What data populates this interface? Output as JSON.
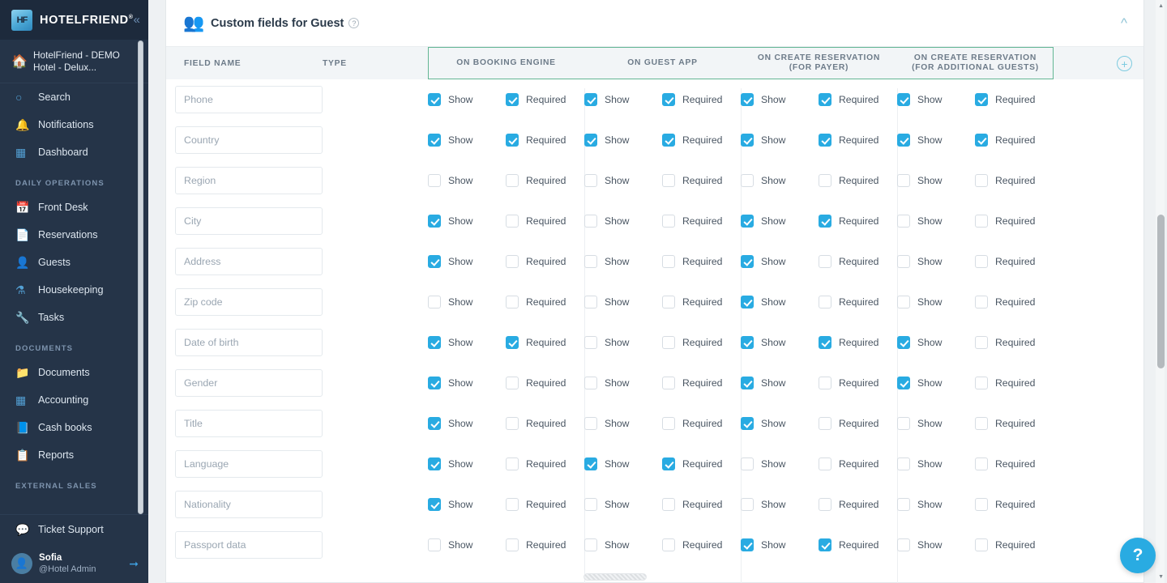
{
  "sidebar": {
    "brand": {
      "name": "HOTELFRIEND",
      "registered": "®",
      "logo_icon": "hotelfriend-cube-icon",
      "collapse_icon": "chevron-double-left-icon"
    },
    "hotel": {
      "icon": "home-icon",
      "line1": "HotelFriend - DEMO",
      "line2": "Hotel - Delux..."
    },
    "top_items": [
      {
        "label": "Search",
        "icon": "search-icon"
      },
      {
        "label": "Notifications",
        "icon": "bell-icon"
      },
      {
        "label": "Dashboard",
        "icon": "grid-icon"
      }
    ],
    "sections": [
      {
        "title": "DAILY OPERATIONS",
        "items": [
          {
            "label": "Front Desk",
            "icon": "calendar-icon"
          },
          {
            "label": "Reservations",
            "icon": "document-icon"
          },
          {
            "label": "Guests",
            "icon": "user-icon"
          },
          {
            "label": "Housekeeping",
            "icon": "housekeeping-icon"
          },
          {
            "label": "Tasks",
            "icon": "wrench-icon"
          }
        ]
      },
      {
        "title": "DOCUMENTS",
        "items": [
          {
            "label": "Documents",
            "icon": "folder-icon"
          },
          {
            "label": "Accounting",
            "icon": "accounting-icon"
          },
          {
            "label": "Cash books",
            "icon": "book-icon"
          },
          {
            "label": "Reports",
            "icon": "report-icon"
          }
        ]
      },
      {
        "title": "EXTERNAL SALES",
        "items": []
      }
    ],
    "support": {
      "label": "Ticket Support",
      "icon": "chat-icon"
    },
    "user": {
      "name": "Sofia",
      "role": "@Hotel Admin",
      "avatar_icon": "avatar-icon",
      "logout_icon": "logout-arrow-icon"
    }
  },
  "header": {
    "icon": "guests-group-icon",
    "title": "Custom fields for Guest",
    "help_icon": "question-circle-icon",
    "collapse_icon": "chevron-up-icon"
  },
  "table": {
    "columns": {
      "field_name": "FIELD NAME",
      "type": "TYPE",
      "groups": [
        {
          "title": "ON BOOKING ENGINE",
          "subtitle": ""
        },
        {
          "title": "ON GUEST APP",
          "subtitle": ""
        },
        {
          "title": "ON CREATE RESERVATION",
          "subtitle": "(FOR PAYER)"
        },
        {
          "title": "ON CREATE RESERVATION",
          "subtitle": "(FOR ADDITIONAL GUESTS)"
        }
      ]
    },
    "checkbox_labels": {
      "show": "Show",
      "required": "Required"
    },
    "add_column_icon": "plus-circle-icon",
    "rows": [
      {
        "field": "Phone",
        "type": "",
        "booking": [
          true,
          true
        ],
        "guest_app": [
          true,
          true
        ],
        "payer": [
          true,
          true
        ],
        "additional": [
          true,
          true
        ]
      },
      {
        "field": "Country",
        "type": "",
        "booking": [
          true,
          true
        ],
        "guest_app": [
          true,
          true
        ],
        "payer": [
          true,
          true
        ],
        "additional": [
          true,
          true
        ]
      },
      {
        "field": "Region",
        "type": "",
        "booking": [
          false,
          false
        ],
        "guest_app": [
          false,
          false
        ],
        "payer": [
          false,
          false
        ],
        "additional": [
          false,
          false
        ]
      },
      {
        "field": "City",
        "type": "",
        "booking": [
          true,
          false
        ],
        "guest_app": [
          false,
          false
        ],
        "payer": [
          true,
          true
        ],
        "additional": [
          false,
          false
        ]
      },
      {
        "field": "Address",
        "type": "",
        "booking": [
          true,
          false
        ],
        "guest_app": [
          false,
          false
        ],
        "payer": [
          true,
          false
        ],
        "additional": [
          false,
          false
        ]
      },
      {
        "field": "Zip code",
        "type": "",
        "booking": [
          false,
          false
        ],
        "guest_app": [
          false,
          false
        ],
        "payer": [
          true,
          false
        ],
        "additional": [
          false,
          false
        ]
      },
      {
        "field": "Date of birth",
        "type": "",
        "booking": [
          true,
          true
        ],
        "guest_app": [
          false,
          false
        ],
        "payer": [
          true,
          true
        ],
        "additional": [
          true,
          false
        ]
      },
      {
        "field": "Gender",
        "type": "",
        "booking": [
          true,
          false
        ],
        "guest_app": [
          false,
          false
        ],
        "payer": [
          true,
          false
        ],
        "additional": [
          true,
          false
        ]
      },
      {
        "field": "Title",
        "type": "",
        "booking": [
          true,
          false
        ],
        "guest_app": [
          false,
          false
        ],
        "payer": [
          true,
          false
        ],
        "additional": [
          false,
          false
        ]
      },
      {
        "field": "Language",
        "type": "",
        "booking": [
          true,
          false
        ],
        "guest_app": [
          true,
          true
        ],
        "payer": [
          false,
          false
        ],
        "additional": [
          false,
          false
        ]
      },
      {
        "field": "Nationality",
        "type": "",
        "booking": [
          true,
          false
        ],
        "guest_app": [
          false,
          false
        ],
        "payer": [
          false,
          false
        ],
        "additional": [
          false,
          false
        ]
      },
      {
        "field": "Passport data",
        "type": "",
        "booking": [
          false,
          false
        ],
        "guest_app": [
          false,
          false
        ],
        "payer": [
          true,
          true
        ],
        "additional": [
          false,
          false
        ]
      }
    ]
  },
  "help_fab": {
    "label": "?",
    "icon": "question-mark-icon"
  },
  "colors": {
    "sidebar_bg": "#253448",
    "accent_blue": "#29abe2",
    "highlight_green": "#63b694",
    "header_row_bg": "#f2f5f7"
  }
}
